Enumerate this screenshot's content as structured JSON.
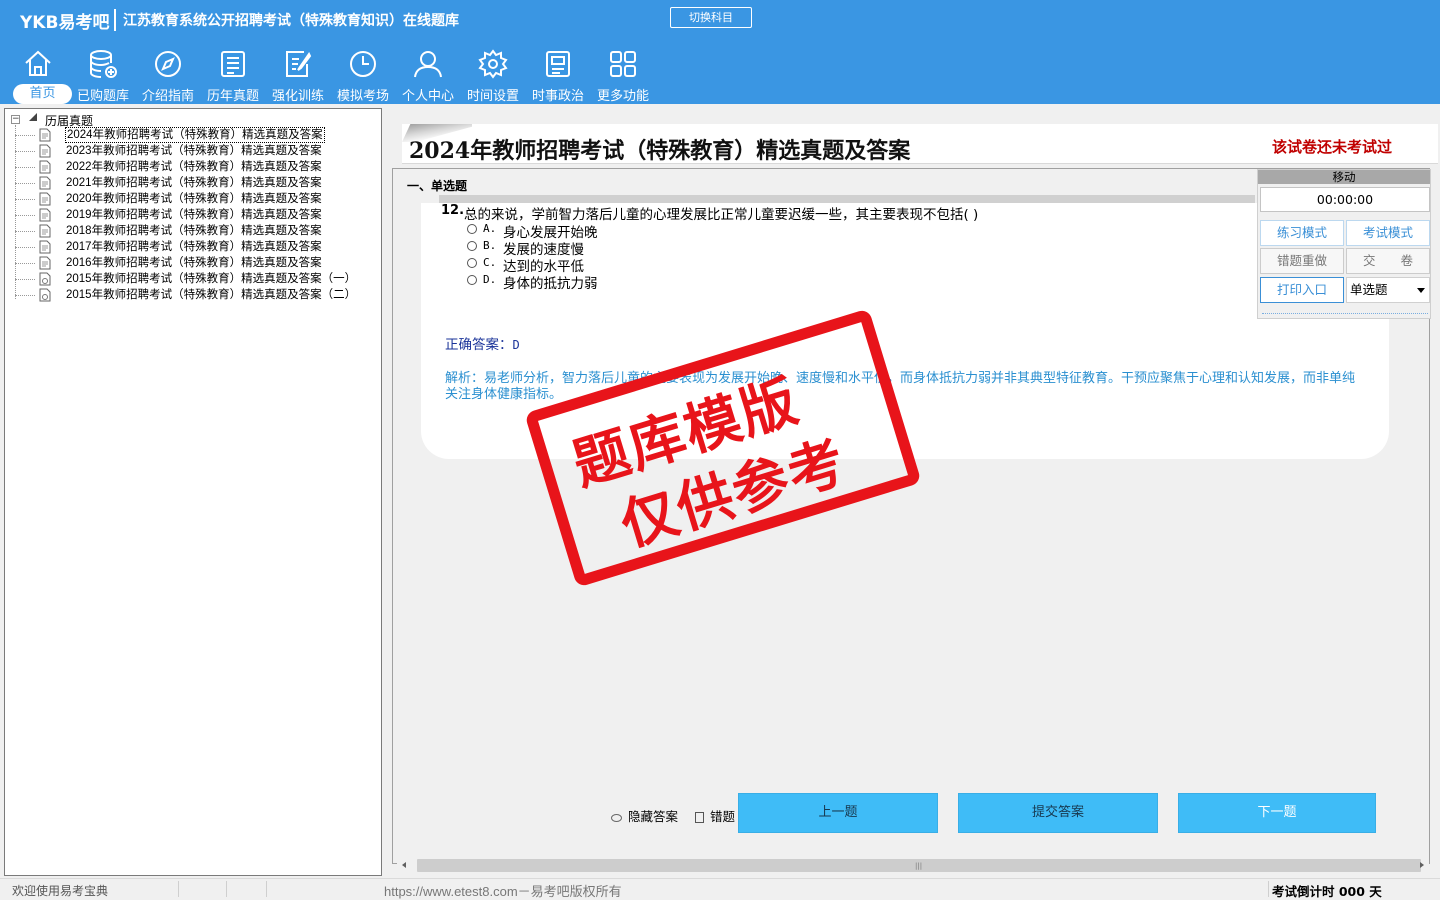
{
  "header": {
    "logo": "YKB易考吧",
    "app_title": "江苏教育系统公开招聘考试（特殊教育知识）在线题库",
    "switch_subject": "切换科目",
    "nav": [
      {
        "label": "首页",
        "icon": "home-icon",
        "active": true
      },
      {
        "label": "已购题库",
        "icon": "database-icon"
      },
      {
        "label": "介绍指南",
        "icon": "compass-icon"
      },
      {
        "label": "历年真题",
        "icon": "document-list-icon"
      },
      {
        "label": "强化训练",
        "icon": "edit-icon"
      },
      {
        "label": "模拟考场",
        "icon": "clock-icon"
      },
      {
        "label": "个人中心",
        "icon": "user-icon"
      },
      {
        "label": "时间设置",
        "icon": "gear-icon"
      },
      {
        "label": "时事政治",
        "icon": "newspaper-icon"
      },
      {
        "label": "更多功能",
        "icon": "grid-icon"
      }
    ]
  },
  "tree": {
    "root_label": "历届真题",
    "items": [
      "2024年教师招聘考试（特殊教育）精选真题及答案",
      "2023年教师招聘考试（特殊教育）精选真题及答案",
      "2022年教师招聘考试（特殊教育）精选真题及答案",
      "2021年教师招聘考试（特殊教育）精选真题及答案",
      "2020年教师招聘考试（特殊教育）精选真题及答案",
      "2019年教师招聘考试（特殊教育）精选真题及答案",
      "2018年教师招聘考试（特殊教育）精选真题及答案",
      "2017年教师招聘考试（特殊教育）精选真题及答案",
      "2016年教师招聘考试（特殊教育）精选真题及答案",
      "2015年教师招聘考试（特殊教育）精选真题及答案（一）",
      "2015年教师招聘考试（特殊教育）精选真题及答案（二）"
    ]
  },
  "paper": {
    "title": "2024年教师招聘考试（特殊教育）精选真题及答案",
    "status": "该试卷还未考试过"
  },
  "question": {
    "section": "一、单选题",
    "number": "12.",
    "text": "总的来说，学前智力落后儿童的心理发展比正常儿童要迟缓一些，其主要表现不包括( )",
    "options": [
      {
        "letter": "A.",
        "text": "身心发展开始晚"
      },
      {
        "letter": "B.",
        "text": "发展的速度慢"
      },
      {
        "letter": "C.",
        "text": "达到的水平低"
      },
      {
        "letter": "D.",
        "text": "身体的抵抗力弱"
      }
    ],
    "answer_label": "正确答案：",
    "answer_value": "D",
    "analysis": "解析：易老师分析，智力落后儿童的主要表现为发展开始晚、速度慢和水平低，而身体抵抗力弱并非其典型特征教育。干预应聚焦于心理和认知发展，而非单纯关注身体健康指标。"
  },
  "side_panel": {
    "move": "移动",
    "timer": "00:00:00",
    "practice_mode": "练习模式",
    "exam_mode": "考试模式",
    "redo_wrong": "错题重做",
    "submit_paper": "交　　卷",
    "print": "打印入口",
    "question_type": "单选题"
  },
  "stamp": {
    "line1": "题库模版",
    "line2": "仅供参考"
  },
  "bottom": {
    "hide_answer": "隐藏答案",
    "wrong_book": "错题本",
    "prev": "上一题",
    "submit_answer": "提交答案",
    "next": "下一题"
  },
  "status_bar": {
    "welcome": "欢迎使用易考宝典",
    "copyright": "https://www.etest8.com－易考吧版权所有",
    "countdown": "考试倒计时 000 天"
  }
}
